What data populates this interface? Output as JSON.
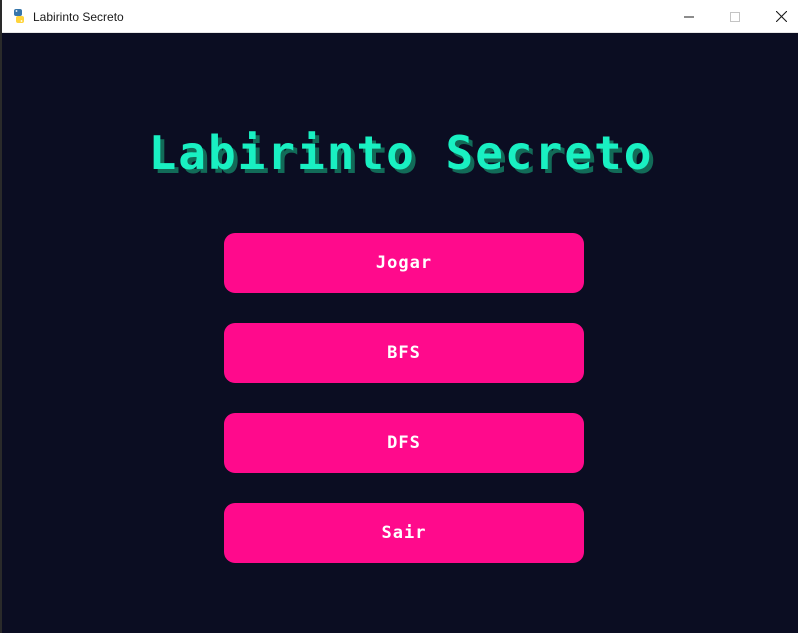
{
  "window": {
    "title": "Labirinto Secreto",
    "icon": "python-icon",
    "controls": [
      "minimize-icon",
      "maximize-icon",
      "close-icon"
    ]
  },
  "game": {
    "title": "Labirinto Secreto",
    "title_color": "#19f0c2",
    "title_shadow_color": "#126b58",
    "background_color": "#0b0d22",
    "button_color": "#ff0a8c",
    "menu": [
      {
        "label": "Jogar"
      },
      {
        "label": "BFS"
      },
      {
        "label": "DFS"
      },
      {
        "label": "Sair"
      }
    ]
  }
}
